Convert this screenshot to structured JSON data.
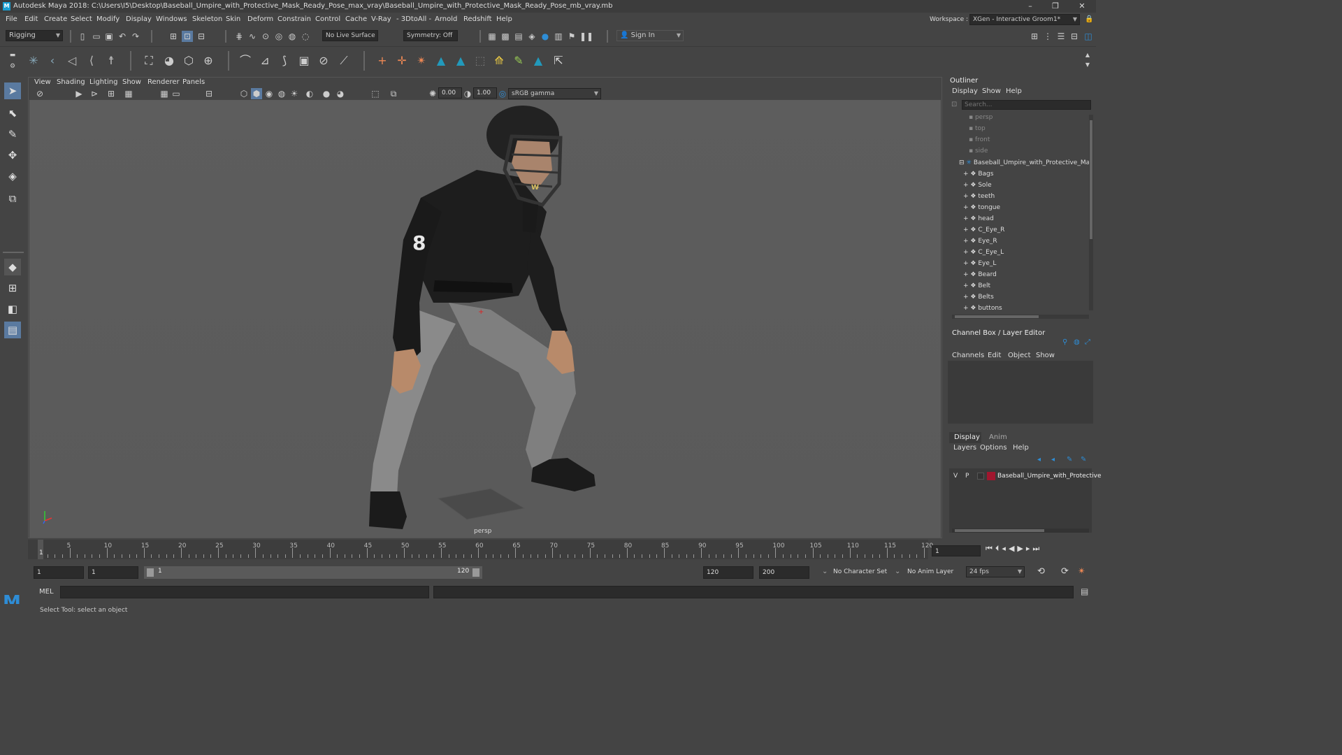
{
  "window": {
    "title": "Autodesk Maya 2018: C:\\Users\\I5\\Desktop\\Baseball_Umpire_with_Protective_Mask_Ready_Pose_max_vray\\Baseball_Umpire_with_Protective_Mask_Ready_Pose_mb_vray.mb",
    "minimize": "–",
    "restore": "❐",
    "close": "✕"
  },
  "menubar": {
    "items": [
      "File",
      "Edit",
      "Create",
      "Select",
      "Modify",
      "Display",
      "Windows",
      "Skeleton",
      "Skin",
      "Deform",
      "Constrain",
      "Control",
      "Cache",
      "V-Ray",
      "- 3DtoAll -",
      "Arnold",
      "Redshift",
      "Help"
    ],
    "workspace_label": "Workspace :",
    "workspace_value": "XGen - Interactive Groom1*"
  },
  "statusline": {
    "menuset": "Rigging",
    "live_surface": "No Live Surface",
    "symmetry": "Symmetry: Off",
    "sign_in": "Sign In"
  },
  "viewport": {
    "menus": [
      "View",
      "Shading",
      "Lighting",
      "Show",
      "Renderer",
      "Panels"
    ],
    "exposure": "0.00",
    "gamma": "1.00",
    "color_space": "sRGB gamma",
    "camera_label": "persp",
    "jersey_number": "8",
    "logo_letter": "W"
  },
  "outliner": {
    "title": "Outliner",
    "menus": [
      "Display",
      "Show",
      "Help"
    ],
    "search_placeholder": "Search...",
    "cameras": [
      "persp",
      "top",
      "front",
      "side"
    ],
    "root": "Baseball_Umpire_with_Protective_Ma:",
    "children": [
      "Bags",
      "Sole",
      "teeth",
      "tongue",
      "head",
      "C_Eye_R",
      "Eye_R",
      "C_Eye_L",
      "Eye_L",
      "Beard",
      "Belt",
      "Belts",
      "buttons"
    ]
  },
  "channelbox": {
    "title": "Channel Box / Layer Editor",
    "menus": [
      "Channels",
      "Edit",
      "Object",
      "Show"
    ]
  },
  "layereditor": {
    "tabs": [
      "Display",
      "Anim"
    ],
    "menus": [
      "Layers",
      "Options",
      "Help"
    ],
    "layer": {
      "v": "V",
      "p": "P",
      "name": "Baseball_Umpire_with_Protective",
      "color": "#a0162e"
    }
  },
  "timeline": {
    "ticks": [
      "5",
      "10",
      "15",
      "20",
      "25",
      "30",
      "35",
      "40",
      "45",
      "50",
      "55",
      "60",
      "65",
      "70",
      "75",
      "80",
      "85",
      "90",
      "95",
      "100",
      "105",
      "110",
      "115",
      "120"
    ],
    "start_marker": "1",
    "current_frame": "1"
  },
  "range": {
    "start": "1",
    "anim_start": "1",
    "slider_start": "1",
    "slider_end": "120",
    "anim_end": "120",
    "end": "200",
    "character_set": "No Character Set",
    "anim_layer": "No Anim Layer",
    "fps": "24 fps"
  },
  "cmdline": {
    "label": "MEL"
  },
  "helpline": {
    "text": "Select Tool: select an object"
  }
}
